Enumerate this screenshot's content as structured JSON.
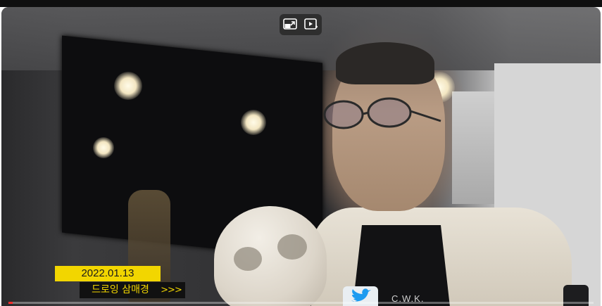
{
  "player": {
    "progress_percent": 0.7,
    "controls": {
      "miniplayer_icon": "miniplayer-icon",
      "autoplay_icon": "play-next-icon"
    }
  },
  "caption": {
    "date": "2022.01.13",
    "title": "드로잉 삼매경",
    "arrows": ">>>"
  },
  "watermark": {
    "brand_icon": "twitter-bird-icon",
    "text": "C.W.K."
  },
  "colors": {
    "caption_yellow": "#f2d600",
    "progress_red": "#ff2f2f",
    "twitter_blue": "#1d9bf0"
  }
}
